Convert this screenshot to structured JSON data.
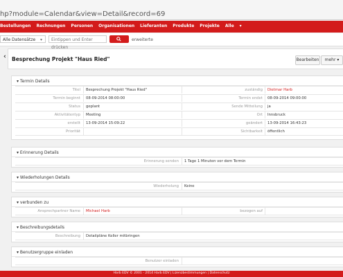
{
  "browser": {
    "url": "hp?module=Calendar&view=Detail&record=69"
  },
  "nav": {
    "items": [
      "Bestellungen",
      "Rechnungen",
      "Personen",
      "Organisationen",
      "Lieferanten",
      "Produkte",
      "Projekte",
      "Alle"
    ]
  },
  "search": {
    "scope": "Alle Datensätze",
    "placeholder": "Eintippen und Enter drücken",
    "advanced": "erweiterte"
  },
  "header": {
    "title": "Besprechung Projekt \"Haus Ried\"",
    "edit": "Bearbeiten",
    "more": "mehr"
  },
  "termin": {
    "label": "Termin Details",
    "rows": [
      {
        "k1": "Titel",
        "v1": "Besprechung Projekt \"Haus Ried\"",
        "k2": "zuständig",
        "v2": "Dietmar Harb"
      },
      {
        "k1": "Termin beginnt",
        "v1": "08-09-2014 08:00:00",
        "k2": "Termin endet",
        "v2": "08-09-2014 09:00:00"
      },
      {
        "k1": "Status",
        "v1": "geplant",
        "k2": "Sende Mitteilung",
        "v2": "ja"
      },
      {
        "k1": "Aktivitätentyp",
        "v1": "Meeting",
        "k2": "Ort",
        "v2": "Innsbruck"
      },
      {
        "k1": "erstellt",
        "v1": "13-09-2014 15:09:22",
        "k2": "geändert",
        "v2": "13-09-2014 16:43:23"
      },
      {
        "k1": "Priorität",
        "v1": "",
        "k2": "Sichtbarkeit",
        "v2": "öffentlich"
      }
    ]
  },
  "erinnerung": {
    "label": "Erinnerung Details",
    "key": "Erinnerung senden",
    "value": "1 Tage 1 Minuten vor dem Termin"
  },
  "wiederholung": {
    "label": "Wiederholungen Details",
    "key": "Wiederholung",
    "value": "Keine"
  },
  "verbunden": {
    "label": "verbunden zu",
    "k1": "Ansprechpartner Name",
    "v1": "Michael Harb",
    "k2": "bezogen auf",
    "v2": ""
  },
  "beschreibung": {
    "label": "Beschreibungsdetails",
    "key": "Beschreibung",
    "value": "Detailpläne Keller mitbringen"
  },
  "benutzer": {
    "label": "Benutzergruppe einladen",
    "key": "Benutzer einladen",
    "value": ""
  },
  "footer": {
    "text": "Harb EDV  © 2001 - 2014  Harb EDV  |  Lizenzbestimmungen  |  Datenschutz"
  }
}
